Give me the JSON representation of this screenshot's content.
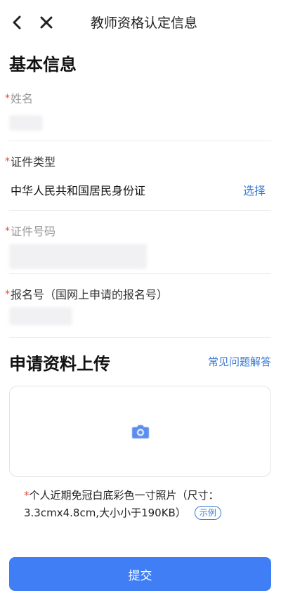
{
  "header": {
    "title": "教师资格认定信息",
    "back_icon": "chevron-left-icon",
    "close_icon": "close-icon"
  },
  "basic_info": {
    "section_title": "基本信息",
    "name": {
      "required_mark": "*",
      "label": "姓名"
    },
    "id_type": {
      "required_mark": "*",
      "label": "证件类型",
      "value": "中华人民共和国居民身份证",
      "select_label": "选择"
    },
    "id_number": {
      "required_mark": "*",
      "label": "证件号码"
    },
    "registration_no": {
      "required_mark": "*",
      "label": "报名号（国网上申请的报名号）"
    }
  },
  "upload": {
    "section_title": "申请资料上传",
    "faq_label": "常见问题解答",
    "camera_icon": "camera-icon",
    "required_mark": "*",
    "hint_text": "个人近期免冠白底彩色一寸照片（尺寸：3.3cmx4.8cm,大小小于190KB）",
    "example_label": "示例"
  },
  "submit": {
    "label": "提交"
  },
  "colors": {
    "accent": "#3f7ef5",
    "link": "#3a7bd5",
    "required": "#e54d42"
  }
}
